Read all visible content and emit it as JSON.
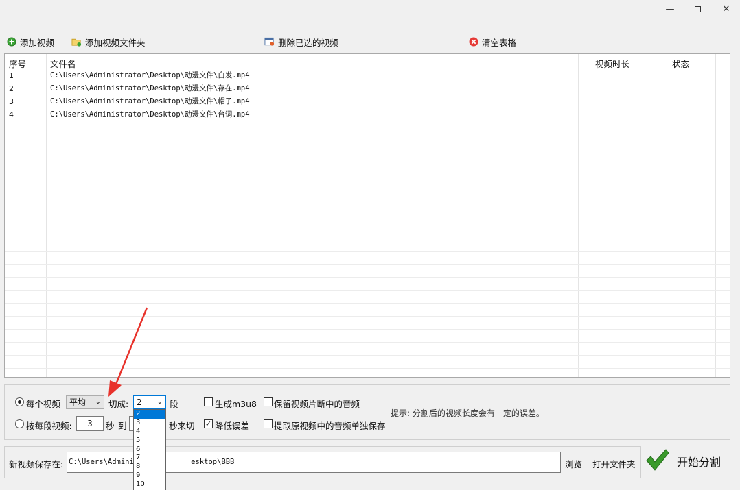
{
  "toolbar": {
    "add_video": "添加视频",
    "add_folder": "添加视频文件夹",
    "delete_selected": "删除已选的视频",
    "clear_table": "清空表格"
  },
  "table": {
    "headers": [
      "序号",
      "文件名",
      "视频时长",
      "状态"
    ],
    "rows": [
      {
        "index": "1",
        "file": "C:\\Users\\Administrator\\Desktop\\动漫文件\\白发.mp4",
        "duration": "",
        "status": ""
      },
      {
        "index": "2",
        "file": "C:\\Users\\Administrator\\Desktop\\动漫文件\\存在.mp4",
        "duration": "",
        "status": ""
      },
      {
        "index": "3",
        "file": "C:\\Users\\Administrator\\Desktop\\动漫文件\\帽子.mp4",
        "duration": "",
        "status": ""
      },
      {
        "index": "4",
        "file": "C:\\Users\\Administrator\\Desktop\\动漫文件\\台词.mp4",
        "duration": "",
        "status": ""
      }
    ]
  },
  "options": {
    "per_video_label": "每个视频",
    "mode_value": "平均",
    "cut_into_label": "切成:",
    "segments_value": "2",
    "segments_unit": "段",
    "generate_m3u8": "生成m3u8",
    "keep_audio": "保留视频片断中的音频",
    "per_segment_label": "按每段视频:",
    "seconds_value": "3",
    "seconds_unit": "秒",
    "to_label": "到",
    "seconds_cut_label": "秒来切",
    "reduce_error": "降低误差",
    "extract_audio": "提取原视频中的音频单独保存",
    "hint": "提示: 分割后的视频长度会有一定的误差。",
    "dropdown_options": [
      "2",
      "3",
      "4",
      "5",
      "6",
      "7",
      "8",
      "9",
      "10"
    ]
  },
  "save": {
    "label": "新视频保存在:",
    "path_visible_start": "C:\\Users\\Adminis",
    "path_visible_end": "esktop\\BBB",
    "browse": "浏览",
    "open_folder": "打开文件夹"
  },
  "start_button": "开始分割",
  "colors": {
    "selection": "#0078d7",
    "annotation_arrow": "#e8322b",
    "checkmark": "#3a9a2b"
  }
}
